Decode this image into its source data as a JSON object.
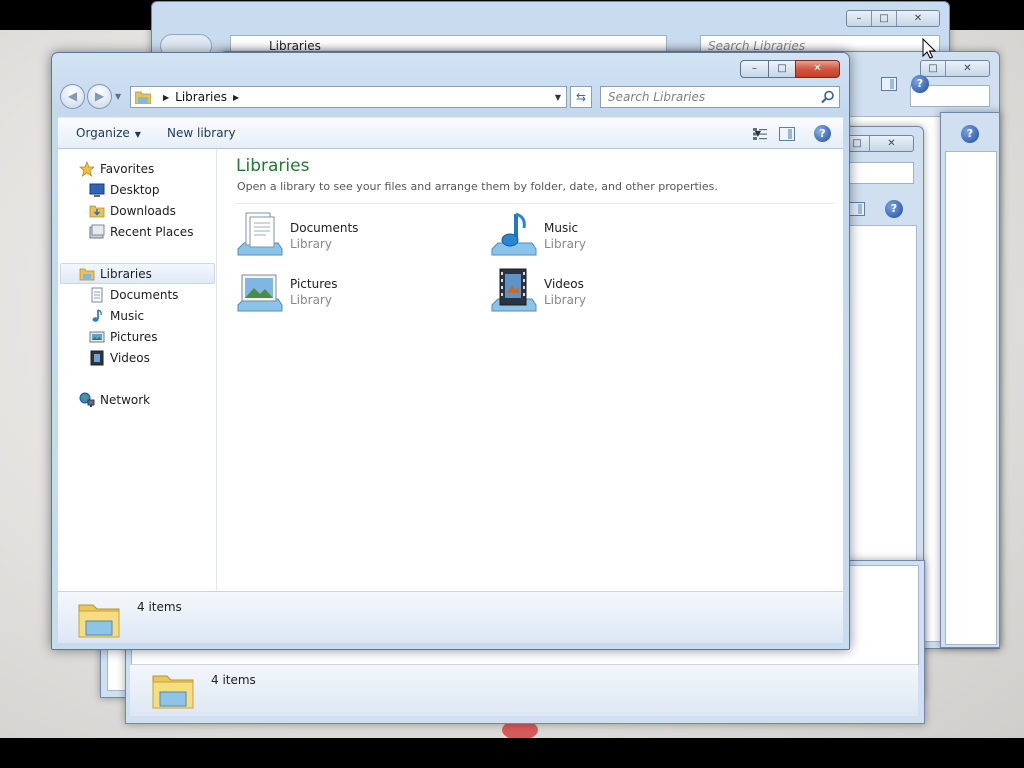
{
  "background_windows": {
    "top_window": {
      "breadcrumb": "Libraries",
      "search_placeholder": "Search Libraries"
    },
    "bottom_window": {
      "item_count": "4 items"
    }
  },
  "window": {
    "caption_buttons": [
      "minimize",
      "maximize",
      "close"
    ],
    "address": {
      "crumbs": [
        "Libraries"
      ]
    },
    "search_placeholder": "Search Libraries",
    "toolbar": {
      "organize_label": "Organize",
      "new_library_label": "New library"
    },
    "nav": {
      "favorites": {
        "label": "Favorites",
        "items": [
          {
            "label": "Desktop",
            "icon": "desktop-icon"
          },
          {
            "label": "Downloads",
            "icon": "downloads-icon"
          },
          {
            "label": "Recent Places",
            "icon": "recent-places-icon"
          }
        ]
      },
      "libraries": {
        "label": "Libraries",
        "items": [
          {
            "label": "Documents",
            "icon": "documents-icon"
          },
          {
            "label": "Music",
            "icon": "music-icon"
          },
          {
            "label": "Pictures",
            "icon": "pictures-icon"
          },
          {
            "label": "Videos",
            "icon": "videos-icon"
          }
        ]
      },
      "network": {
        "label": "Network"
      }
    },
    "content": {
      "title": "Libraries",
      "subtitle": "Open a library to see your files and arrange them by folder, date, and other properties.",
      "libraries": [
        {
          "name": "Documents",
          "type": "Library"
        },
        {
          "name": "Music",
          "type": "Library"
        },
        {
          "name": "Pictures",
          "type": "Library"
        },
        {
          "name": "Videos",
          "type": "Library"
        }
      ]
    },
    "details": {
      "item_count": "4 items"
    }
  }
}
